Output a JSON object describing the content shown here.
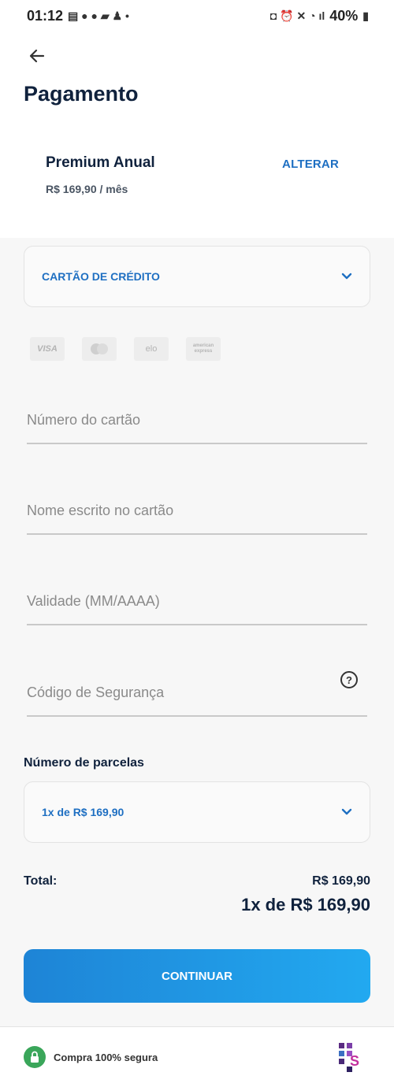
{
  "status_bar": {
    "time": "01:12",
    "battery": "40%"
  },
  "header": {
    "back_icon": "arrow-left-icon",
    "title": "Pagamento"
  },
  "plan": {
    "name": "Premium Anual",
    "price": "R$ 169,90 / mês",
    "change_label": "ALTERAR"
  },
  "payment_method": {
    "selected": "CARTÃO DE CRÉDITO",
    "icon": "chevron-down-icon"
  },
  "card_brands": [
    "VISA",
    "mastercard",
    "elo",
    "american express"
  ],
  "form": {
    "card_number_placeholder": "Número do cartão",
    "card_name_placeholder": "Nome escrito no cartão",
    "expiry_placeholder": "Validade (MM/AAAA)",
    "security_code_placeholder": "Código de Segurança",
    "help_icon": "question-circle-icon"
  },
  "installments": {
    "title": "Número de parcelas",
    "selected": "1x de R$ 169,90"
  },
  "total": {
    "label": "Total:",
    "value": "R$ 169,90",
    "installment_summary": "1x de R$ 169,90"
  },
  "continue_label": "CONTINUAR",
  "footer": {
    "secure_text": "Compra 100% segura",
    "lock_icon": "lock-icon",
    "logo_icon": "brand-logo-icon",
    "colors": {
      "secure_green": "#3aa65a",
      "accent_blue": "#1e6fc2"
    }
  }
}
